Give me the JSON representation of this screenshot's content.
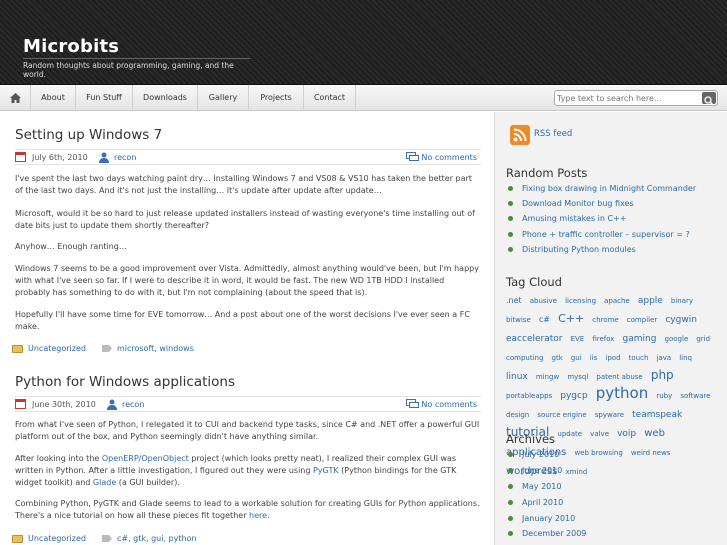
{
  "header": {
    "title": "Microbits",
    "description": "Random thoughts about programming, gaming, and the world."
  },
  "nav": {
    "items": [
      "About",
      "Fun Stuff",
      "Downloads",
      "Gallery",
      "Projects",
      "Contact"
    ]
  },
  "search": {
    "placeholder": "Type text to search here..."
  },
  "posts": [
    {
      "title": "Setting up Windows 7",
      "date": "July 6th, 2010",
      "author": "recon",
      "comments": "No comments",
      "paragraphs": [
        "I've spent the last two days watching paint dry… Installing Windows 7 and VS08 & VS10 has taken the better part of the last two days. And it's not just the installing… It's update after update after update…",
        "Microsoft, would it be so hard to just release updated installers instead of wasting everyone's time installing out of date bits just to update them shortly thereafter?",
        "Anyhow… Enough ranting…",
        "Windows 7 seems to be a good improvement over Vista. Admittedly, almost anything would've been, but I'm happy with what I've seen so far. If I were to describe it in word, it would be fast. The new WD 1TB HDD I installed probably has something to do with it, but I'm not complaining (about the speed that is).",
        "Hopefully I'll have some time for EVE tomorrow… And a post about one of the worst decisions I've ever seen a FC make."
      ],
      "category": "Uncategorized",
      "tags": "microsoft, windows"
    },
    {
      "title": "Python for Windows applications",
      "date": "June 30th, 2010",
      "author": "recon",
      "comments": "No comments",
      "p1": "From what I've seen of Python, I relegated it to CUI and backend type tasks, since C# and .NET offer a powerful GUI platform out of the box, and Python seemingly didn't have anything similar.",
      "p2a": "After looking into the ",
      "p2link1": "OpenERP/OpenObject",
      "p2b": " project (which looks pretty neat), I realized their complex GUI was written in Python. After a little investigation, I figured out they were using ",
      "p2link2": "PyGTK",
      "p2c": " (Python bindings for the GTK widget toolkit) and ",
      "p2link3": "Glade",
      "p2d": " (a GUI builder).",
      "p3a": "Combining Python, PyGTK and Glade seems to lead to a workable solution for creating GUIs for Python applications. There's a nice tutorial on how all these pieces fit together ",
      "p3link": "here",
      "p3b": ".",
      "category": "Uncategorized",
      "tags": "c#, gtk, gui, python"
    }
  ],
  "sidebar": {
    "rss": "RSS feed",
    "random_title": "Random Posts",
    "random_posts": [
      "Fixing box drawing in Midnight Commander",
      "Download Monitor bug fixes",
      "Amusing mistakes in C++",
      "Phone + traffic controller – supervisor = ?",
      "Distributing Python modules"
    ],
    "tagcloud_title": "Tag Cloud",
    "tags": [
      {
        "t": ".net",
        "s": 8
      },
      {
        "t": "abusive",
        "s": 7
      },
      {
        "t": "licensing",
        "s": 7
      },
      {
        "t": "apache",
        "s": 7
      },
      {
        "t": "apple",
        "s": 9
      },
      {
        "t": "binary",
        "s": 7
      },
      {
        "t": "bitwise",
        "s": 7
      },
      {
        "t": "c#",
        "s": 8
      },
      {
        "t": "C++",
        "s": 11
      },
      {
        "t": "chrome",
        "s": 7
      },
      {
        "t": "compiler",
        "s": 7
      },
      {
        "t": "cygwin",
        "s": 9
      },
      {
        "t": "eaccelerator",
        "s": 9
      },
      {
        "t": "EVE",
        "s": 7
      },
      {
        "t": "firefox",
        "s": 7
      },
      {
        "t": "gaming",
        "s": 9
      },
      {
        "t": "google",
        "s": 7
      },
      {
        "t": "grid computing",
        "s": 7
      },
      {
        "t": "gtk",
        "s": 7
      },
      {
        "t": "gui",
        "s": 7
      },
      {
        "t": "iis",
        "s": 7
      },
      {
        "t": "ipod",
        "s": 7
      },
      {
        "t": "touch",
        "s": 7
      },
      {
        "t": "java",
        "s": 7
      },
      {
        "t": "linq",
        "s": 7
      },
      {
        "t": "linux",
        "s": 9
      },
      {
        "t": "mingw",
        "s": 7
      },
      {
        "t": "mysql",
        "s": 7
      },
      {
        "t": "patent abuse",
        "s": 7
      },
      {
        "t": "php",
        "s": 12
      },
      {
        "t": "portableapps",
        "s": 7
      },
      {
        "t": "pygcp",
        "s": 9
      },
      {
        "t": "python",
        "s": 15
      },
      {
        "t": "ruby",
        "s": 7
      },
      {
        "t": "software",
        "s": 7
      },
      {
        "t": "design",
        "s": 7
      },
      {
        "t": "source engine",
        "s": 7
      },
      {
        "t": "spyware",
        "s": 7
      },
      {
        "t": "teamspeak",
        "s": 9
      },
      {
        "t": "tutorial",
        "s": 12
      },
      {
        "t": "update",
        "s": 7
      },
      {
        "t": "valve",
        "s": 7
      },
      {
        "t": "voip",
        "s": 9
      },
      {
        "t": "web applications",
        "s": 10
      },
      {
        "t": "web browsing",
        "s": 7
      },
      {
        "t": "weird news",
        "s": 7
      },
      {
        "t": "wordpress",
        "s": 10
      },
      {
        "t": "xmind",
        "s": 7
      }
    ],
    "archives_title": "Archives",
    "archives": [
      "July 2010",
      "June 2010",
      "May 2010",
      "April 2010",
      "January 2010",
      "December 2009"
    ]
  },
  "colors": {
    "link": "#2b6aa8",
    "bullet": "#4a8a3a",
    "rss": "#f08a24"
  }
}
